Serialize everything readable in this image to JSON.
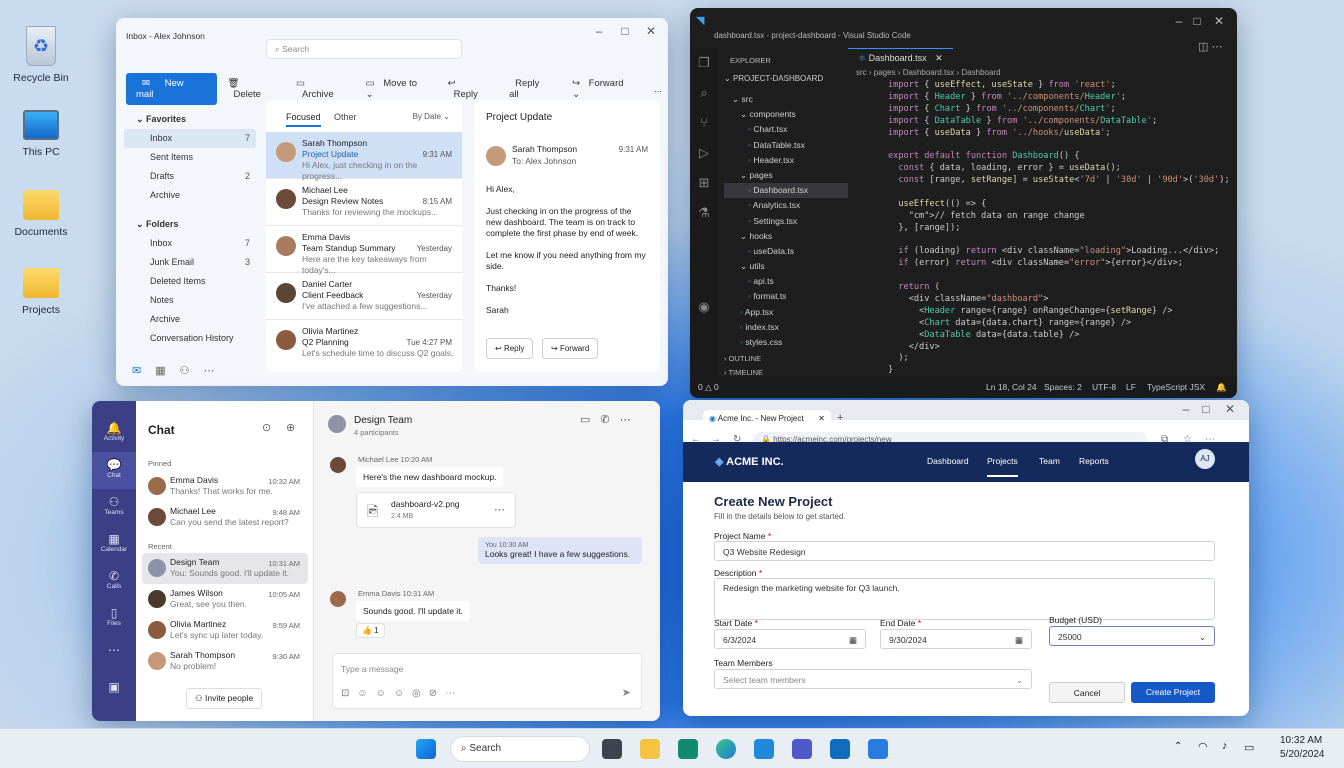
{
  "desktop": {
    "icons": [
      {
        "label": "Recycle Bin"
      },
      {
        "label": "This PC"
      },
      {
        "label": "Documents"
      },
      {
        "label": "Projects"
      }
    ]
  },
  "outlook": {
    "title": "Inbox - Alex Johnson",
    "search_placeholder": "Search",
    "ribbon": {
      "new_mail": "New mail",
      "delete": "Delete",
      "archive": "Archive",
      "move_to": "Move to",
      "reply": "Reply",
      "reply_all": "Reply all",
      "forward": "Forward",
      "more": "..."
    },
    "favorites_label": "Favorites",
    "folders_label": "Folders",
    "favorites": [
      {
        "label": "Inbox",
        "count": "7"
      },
      {
        "label": "Sent Items",
        "count": ""
      },
      {
        "label": "Drafts",
        "count": "2"
      },
      {
        "label": "Archive",
        "count": ""
      }
    ],
    "folders": [
      {
        "label": "Inbox",
        "count": "7"
      },
      {
        "label": "Junk Email",
        "count": "3"
      },
      {
        "label": "Deleted Items",
        "count": ""
      },
      {
        "label": "Notes",
        "count": ""
      },
      {
        "label": "Archive",
        "count": ""
      },
      {
        "label": "Conversation History",
        "count": ""
      }
    ],
    "tabs": {
      "focused": "Focused",
      "other": "Other",
      "sort": "By Date"
    },
    "messages": [
      {
        "sender": "Sarah Thompson",
        "subject": "Project Update",
        "preview": "Hi Alex, just checking in on the progress...",
        "time": "9:31 AM"
      },
      {
        "sender": "Michael Lee",
        "subject": "Design Review Notes",
        "preview": "Thanks for reviewing the mockups...",
        "time": "8:15 AM"
      },
      {
        "sender": "Emma Davis",
        "subject": "Team Standup Summary",
        "preview": "Here are the key takeaways from today's...",
        "time": "Yesterday"
      },
      {
        "sender": "Daniel Carter",
        "subject": "Client Feedback",
        "preview": "I've attached a few suggestions...",
        "time": "Yesterday"
      },
      {
        "sender": "Olivia Martinez",
        "subject": "Q2 Planning",
        "preview": "Let's schedule time to discuss Q2 goals.",
        "time": "Tue 4:27 PM"
      }
    ],
    "reading": {
      "subject": "Project Update",
      "sender": "Sarah Thompson",
      "to": "To: Alex Johnson",
      "time": "9:31 AM",
      "greeting": "Hi Alex,",
      "body1": "Just checking in on the progress of the new dashboard. The team is on track to complete the first phase by end of week.",
      "body2": "Let me know if you need anything from my side.",
      "thanks": "Thanks!",
      "sign": "Sarah",
      "reply": "Reply",
      "forward": "Forward"
    }
  },
  "vscode": {
    "title": "dashboard.tsx - project-dashboard - Visual Studio Code",
    "tab": "Dashboard.tsx",
    "breadcrumb": [
      "src",
      "pages",
      "Dashboard.tsx",
      "Dashboard"
    ],
    "explorer": "EXPLORER",
    "project": "PROJECT-DASHBOARD",
    "tree": [
      {
        "label": "src",
        "indent": 1,
        "type": "folder"
      },
      {
        "label": "components",
        "indent": 2,
        "type": "folder"
      },
      {
        "label": "Chart.tsx",
        "indent": 3,
        "type": "file"
      },
      {
        "label": "DataTable.tsx",
        "indent": 3,
        "type": "file"
      },
      {
        "label": "Header.tsx",
        "indent": 3,
        "type": "file"
      },
      {
        "label": "pages",
        "indent": 2,
        "type": "folder"
      },
      {
        "label": "Dashboard.tsx",
        "indent": 3,
        "type": "file",
        "active": true
      },
      {
        "label": "Analytics.tsx",
        "indent": 3,
        "type": "file"
      },
      {
        "label": "Settings.tsx",
        "indent": 3,
        "type": "file"
      },
      {
        "label": "hooks",
        "indent": 2,
        "type": "folder"
      },
      {
        "label": "useData.ts",
        "indent": 3,
        "type": "file"
      },
      {
        "label": "utils",
        "indent": 2,
        "type": "folder"
      },
      {
        "label": "api.ts",
        "indent": 3,
        "type": "file"
      },
      {
        "label": "format.ts",
        "indent": 3,
        "type": "file"
      },
      {
        "label": "App.tsx",
        "indent": 2,
        "type": "file"
      },
      {
        "label": "index.tsx",
        "indent": 2,
        "type": "file"
      },
      {
        "label": "styles.css",
        "indent": 2,
        "type": "file"
      }
    ],
    "outline": "OUTLINE",
    "timeline": "TIMELINE",
    "code": [
      "import { useEffect, useState } from 'react';",
      "import { Header } from '../components/Header';",
      "import { Chart } from '../components/Chart';",
      "import { DataTable } from '../components/DataTable';",
      "import { useData } from '../hooks/useData';",
      "",
      "export default function Dashboard() {",
      "  const { data, loading, error } = useData();",
      "  const [range, setRange] = useState<'7d' | '30d' | '90d'>('30d');",
      "",
      "  useEffect(() => {",
      "    // fetch data on range change",
      "  }, [range]);",
      "",
      "  if (loading) return <div className=\"loading\">Loading...</div>;",
      "  if (error) return <div className=\"error\">{error}</div>;",
      "",
      "  return (",
      "    <div className=\"dashboard\">",
      "      <Header range={range} onRangeChange={setRange} />",
      "      <Chart data={data.chart} range={range} />",
      "      <DataTable data={data.table} />",
      "    </div>",
      "  );",
      "}"
    ],
    "status": {
      "errors": "0 △ 0",
      "position": "Ln 18, Col 24",
      "spaces": "Spaces: 2",
      "encoding": "UTF-8",
      "eol": "LF",
      "language": "TypeScript JSX"
    }
  },
  "teams": {
    "rail": [
      {
        "label": "Activity"
      },
      {
        "label": "Chat"
      },
      {
        "label": "Teams"
      },
      {
        "label": "Calendar"
      },
      {
        "label": "Calls"
      },
      {
        "label": "Files"
      }
    ],
    "chat_title": "Chat",
    "pinned": "Pinned",
    "recent": "Recent",
    "pinned_chats": [
      {
        "name": "Emma Davis",
        "preview": "Thanks! That works for me.",
        "time": "10:32 AM"
      },
      {
        "name": "Michael Lee",
        "preview": "Can you send the latest report?",
        "time": "9:48 AM"
      }
    ],
    "recent_chats": [
      {
        "name": "Design Team",
        "preview": "You: Sounds good. I'll update it.",
        "time": "10:31 AM"
      },
      {
        "name": "James Wilson",
        "preview": "Great, see you then.",
        "time": "10:05 AM"
      },
      {
        "name": "Olivia Martinez",
        "preview": "Let's sync up later today.",
        "time": "9:59 AM"
      },
      {
        "name": "Sarah Thompson",
        "preview": "No problem!",
        "time": "9:30 AM"
      }
    ],
    "invite": "Invite people",
    "conv": {
      "title": "Design Team",
      "subtitle": "4 participants",
      "m1_meta": "Michael Lee  10:20 AM",
      "m1_text": "Here's the new dashboard mockup.",
      "file_name": "dashboard-v2.png",
      "file_size": "2.4 MB",
      "m2_meta": "You  10:30 AM",
      "m2_text": "Looks great! I have a few suggestions.",
      "m3_meta": "Emma Davis  10:31 AM",
      "m3_text": "Sounds good. I'll update it.",
      "reaction": "👍 1",
      "compose_placeholder": "Type a message"
    }
  },
  "browser": {
    "tab": "Acme Inc. - New Project",
    "url": "https://acmeinc.com/projects/new",
    "brand": "ACME INC.",
    "nav": [
      "Dashboard",
      "Projects",
      "Team",
      "Reports"
    ],
    "user": "AJ",
    "form": {
      "title": "Create New Project",
      "subtitle": "Fill in the details below to get started.",
      "name_label": "Project Name",
      "name_value": "Q3 Website Redesign",
      "desc_label": "Description",
      "desc_value": "Redesign the marketing website for Q3 launch.",
      "start_label": "Start Date",
      "start_value": "6/3/2024",
      "end_label": "End Date",
      "end_value": "9/30/2024",
      "budget_label": "Budget (USD)",
      "budget_value": "25000",
      "members_label": "Team Members",
      "members_placeholder": "Select team members",
      "cancel": "Cancel",
      "create": "Create Project",
      "required": "*"
    }
  },
  "taskbar": {
    "search": "Search",
    "time": "10:32 AM",
    "date": "5/20/2024"
  }
}
